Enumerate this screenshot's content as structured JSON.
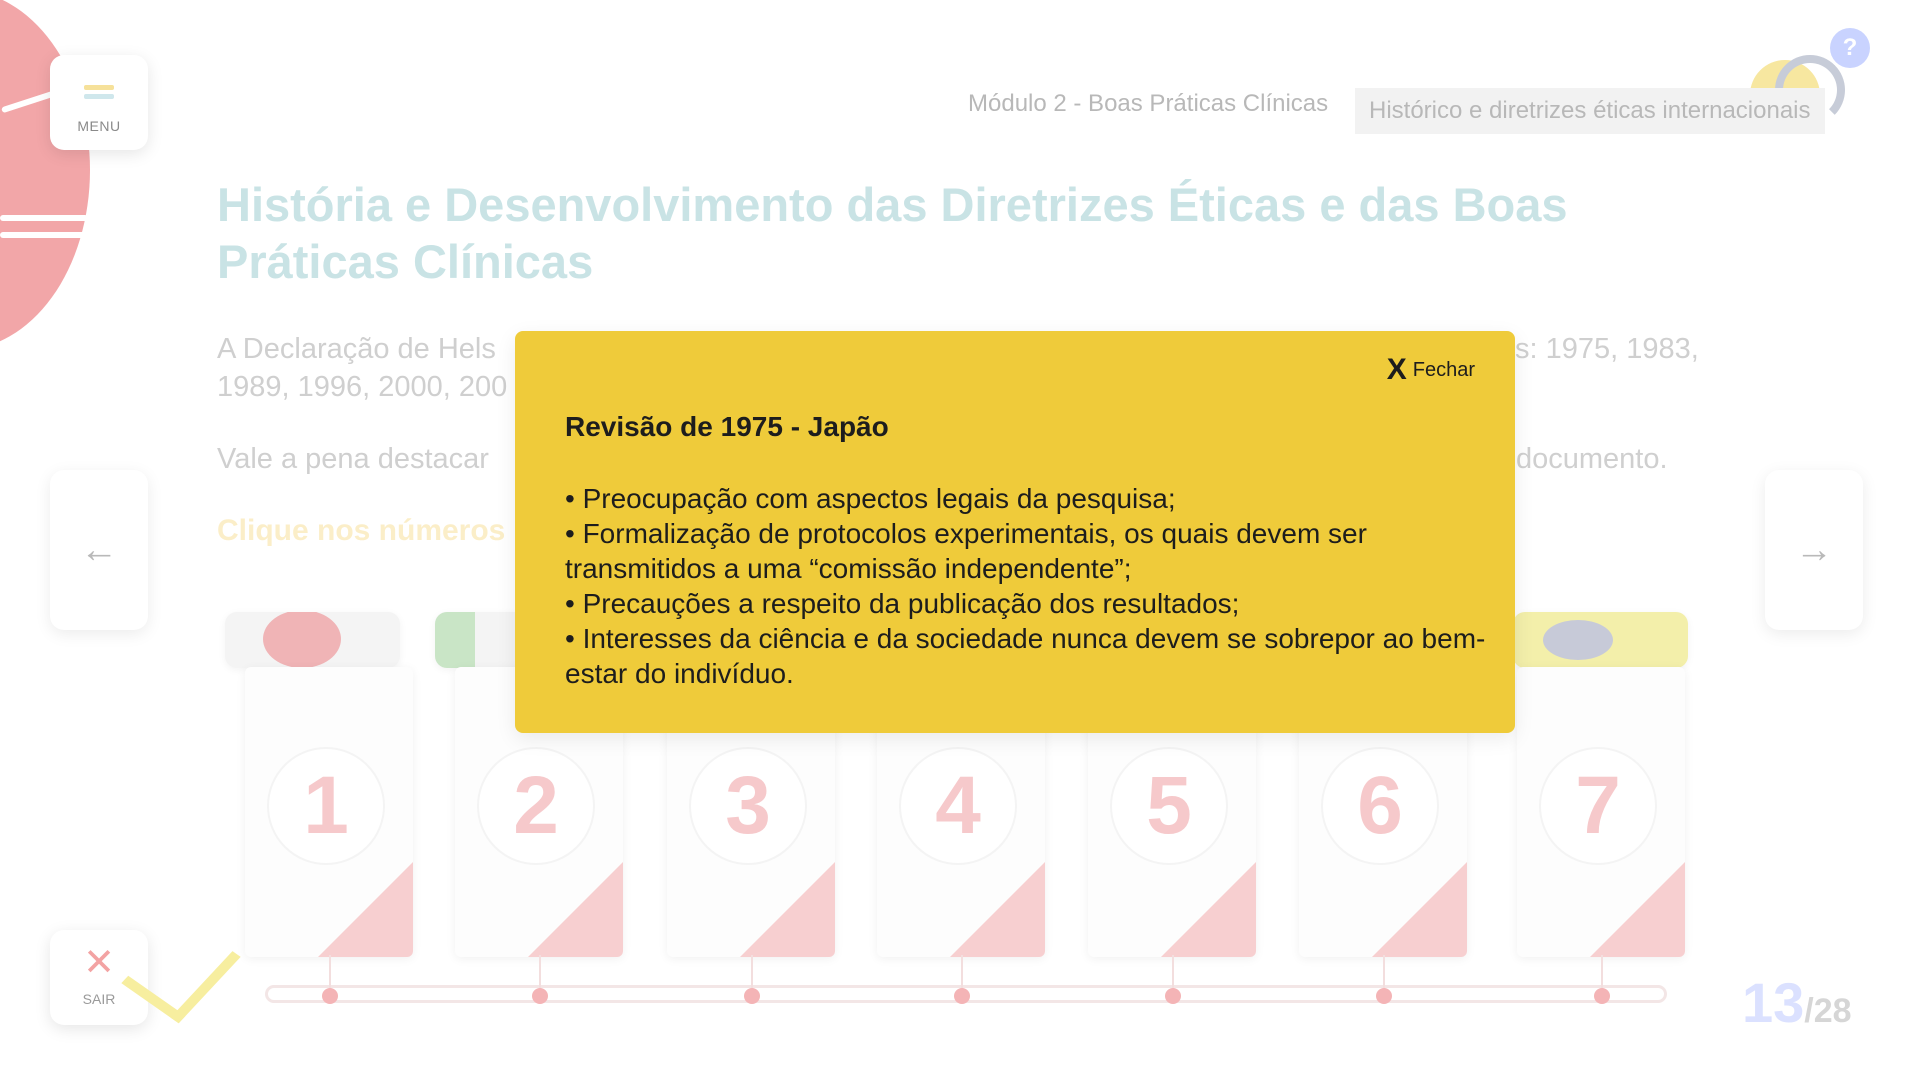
{
  "menu": {
    "label": "MENU"
  },
  "help": {
    "label": "?"
  },
  "breadcrumb": {
    "module": "Módulo 2 - Boas Práticas Clínicas",
    "topic": "Histórico e diretrizes éticas internacionais"
  },
  "title": "História e Desenvolvimento das Diretrizes Éticas e das Boas Práticas Clínicas",
  "paragraphs": {
    "p1_start": "A Declaração de Hels",
    "p1_end": "s: 1975, 1983,",
    "p1_line2": "1989, 1996, 2000, 200",
    "p2_start": "Vale a pena destacar",
    "p2_end": "documento."
  },
  "cta": "Clique nos números",
  "nav": {
    "prev": "←",
    "next": "→"
  },
  "cards": [
    {
      "number": "1",
      "flag": "japan-flag"
    },
    {
      "number": "2",
      "flag": "italy-flag"
    },
    {
      "number": "3",
      "flag": ""
    },
    {
      "number": "4",
      "flag": ""
    },
    {
      "number": "5",
      "flag": ""
    },
    {
      "number": "6",
      "flag": ""
    },
    {
      "number": "7",
      "flag": "brazil-flag"
    }
  ],
  "exit": {
    "icon": "✕",
    "label": "SAIR"
  },
  "pagination": {
    "current": "13",
    "total": "/28"
  },
  "modal": {
    "close_icon": "X",
    "close_label": "Fechar",
    "title": "Revisão de 1975 - Japão",
    "items": [
      "• Preocupação com aspectos legais da pesquisa;",
      "• Formalização de protocolos experimentais, os quais devem ser transmitidos a uma “comissão independente”;",
      "• Precauções a respeito da publicação dos resultados;",
      "• Interesses da ciência e da sociedade nunca devem se sobrepor ao bem-estar do indivíduo."
    ]
  },
  "colors": {
    "accent_yellow": "#efcb3a",
    "title_teal": "#c9e3e5",
    "card_red": "#f7cfd0"
  }
}
